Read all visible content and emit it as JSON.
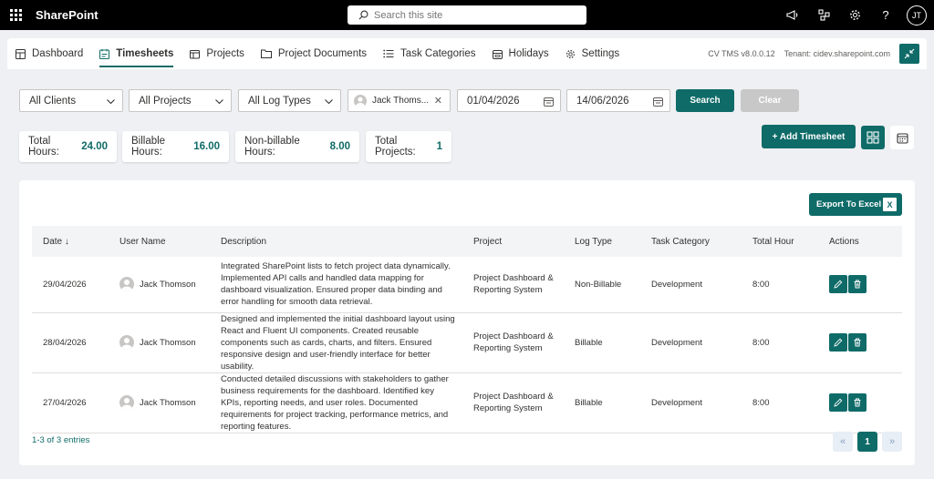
{
  "suite": {
    "brand": "SharePoint",
    "search_placeholder": "Search this site",
    "user_initials": "JT"
  },
  "nav": {
    "items": [
      {
        "label": "Dashboard",
        "icon": "dashboard-icon"
      },
      {
        "label": "Timesheets",
        "icon": "timesheet-icon",
        "active": true
      },
      {
        "label": "Projects",
        "icon": "projects-icon"
      },
      {
        "label": "Project Documents",
        "icon": "folder-icon"
      },
      {
        "label": "Task Categories",
        "icon": "list-icon"
      },
      {
        "label": "Holidays",
        "icon": "calendar-icon"
      },
      {
        "label": "Settings",
        "icon": "gear-icon"
      }
    ],
    "version": "CV TMS v8.0.0.12",
    "tenant": "Tenant: cidev.sharepoint.com"
  },
  "filters": {
    "clients": "All Clients",
    "projects": "All Projects",
    "log_types": "All Log Types",
    "person": "Jack Thoms...",
    "start_date": "01/04/2026",
    "end_date": "14/06/2026",
    "search_label": "Search",
    "clear_label": "Clear"
  },
  "summary": {
    "total_hours_label": "Total Hours:",
    "total_hours": "24.00",
    "billable_label": "Billable Hours:",
    "billable": "16.00",
    "nonbillable_label": "Non-billable Hours:",
    "nonbillable": "8.00",
    "projects_label": "Total Projects:",
    "projects": "1"
  },
  "add_label": "+ Add Timesheet",
  "export_label": "Export To Excel :",
  "table": {
    "headers": [
      "Date ↓",
      "User Name",
      "Description",
      "Project",
      "Log Type",
      "Task Category",
      "Total Hour",
      "Actions"
    ],
    "rows": [
      {
        "date": "29/04/2026",
        "user": "Jack Thomson",
        "desc": "Integrated SharePoint lists to fetch project data dynamically. Implemented API calls and handled data mapping for dashboard visualization. Ensured proper data binding and error handling for smooth data retrieval.",
        "project": "Project Dashboard & Reporting System",
        "logtype": "Non-Billable",
        "category": "Development",
        "hours": "8:00"
      },
      {
        "date": "28/04/2026",
        "user": "Jack Thomson",
        "desc": "Designed and implemented the initial dashboard layout using React and Fluent UI components. Created reusable components such as cards, charts, and filters. Ensured responsive design and user-friendly interface for better usability.",
        "project": "Project Dashboard & Reporting System",
        "logtype": "Billable",
        "category": "Development",
        "hours": "8:00"
      },
      {
        "date": "27/04/2026",
        "user": "Jack Thomson",
        "desc": "Conducted detailed discussions with stakeholders to gather business requirements for the dashboard. Identified key KPIs, reporting needs, and user roles. Documented requirements for project tracking, performance metrics, and reporting features.",
        "project": "Project Dashboard & Reporting System",
        "logtype": "Billable",
        "category": "Development",
        "hours": "8:00"
      }
    ]
  },
  "footer": {
    "entries": "1-3 of 3 entries",
    "page": "1",
    "prev": "«",
    "next": "»"
  },
  "colors": {
    "accent": "#0f6b68",
    "suitebar": "#000000",
    "background": "#eef0f3"
  }
}
